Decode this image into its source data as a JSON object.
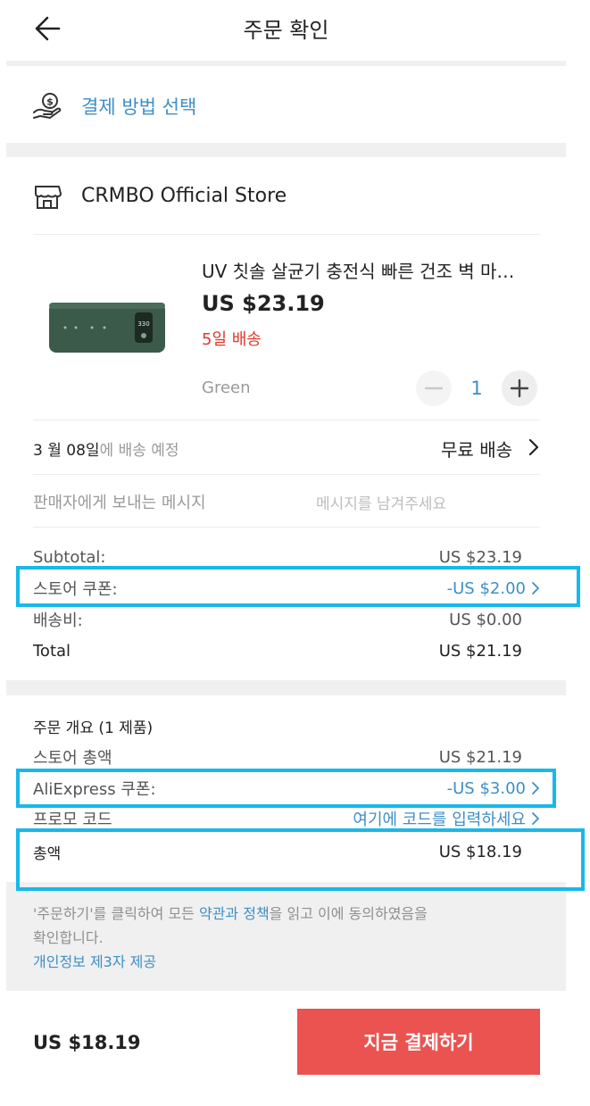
{
  "header": {
    "title": "주문 확인"
  },
  "payment": {
    "label": "결제 방법 선택"
  },
  "store": {
    "name": "CRMBO Official Store"
  },
  "product": {
    "title": "UV 칫솔 살균기 충전식 빠른 건조 벽 마…",
    "price": "US $23.19",
    "delivery_days": "5일 배송",
    "variant": "Green",
    "quantity": "1",
    "image_readout": "330"
  },
  "shipping": {
    "date_bold": "3 월 08일",
    "date_suffix": "에 배송 예정",
    "method": "무료 배송"
  },
  "message": {
    "label": "판매자에게 보내는 메시지",
    "placeholder": "메시지를 남겨주세요"
  },
  "store_summary": {
    "subtotal_label": "Subtotal:",
    "subtotal_value": "US $23.19",
    "coupon_label": "스토어 쿠폰:",
    "coupon_value": "-US $2.00",
    "shipping_label": "배송비:",
    "shipping_value": "US $0.00",
    "total_label": "Total",
    "total_value": "US $21.19"
  },
  "order_summary": {
    "heading": "주문 개요 (1 제품)",
    "store_total_label": "스토어 총액",
    "store_total_value": "US $21.19",
    "ali_coupon_label": "AliExpress 쿠폰:",
    "ali_coupon_value": "-US $3.00",
    "promo_label": "프로모 코드",
    "promo_value": "여기에 코드를 입력하세요",
    "grand_total_label": "총액",
    "grand_total_value": "US $18.19"
  },
  "terms": {
    "text_1": "'주문하기'를 클릭하여 모든 ",
    "link_terms": "약관과 정책",
    "text_2": "을 읽고 이에 동의하였음을",
    "text_3": "확인합니다.",
    "link_privacy": "개인정보 제3자 제공"
  },
  "footer": {
    "total": "US $18.19",
    "pay_button": "지금 결제하기"
  },
  "colors": {
    "accent_blue": "#3d8fc8",
    "highlight": "#17b8ea",
    "pay_button": "#ea5350",
    "delivery_red": "#e0382a"
  },
  "icons": [
    "back-arrow-icon",
    "payment-hand-icon",
    "store-icon",
    "minus-icon",
    "plus-icon",
    "chevron-right-icon"
  ]
}
